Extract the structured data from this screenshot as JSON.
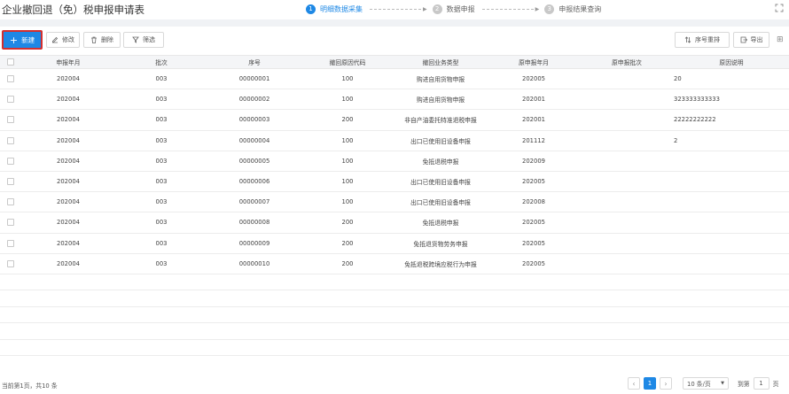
{
  "header": {
    "title": "企业撤回退（免）税申报申请表",
    "steps": [
      {
        "num": "1",
        "label": "明细数据采集"
      },
      {
        "num": "2",
        "label": "数据申报"
      },
      {
        "num": "3",
        "label": "申报结果查询"
      }
    ]
  },
  "toolbar": {
    "new_label": "新建",
    "edit_label": "修改",
    "delete_label": "删除",
    "filter_label": "筛选",
    "reorder_label": "序号重排",
    "export_label": "导出"
  },
  "table": {
    "columns": [
      "申报年月",
      "批次",
      "序号",
      "撤回原因代码",
      "撤回业务类型",
      "原申报年月",
      "原申报批次",
      "原因说明"
    ],
    "rows": [
      [
        "202004",
        "003",
        "00000001",
        "100",
        "购进自用货物申报",
        "202005",
        "",
        "20"
      ],
      [
        "202004",
        "003",
        "00000002",
        "100",
        "购进自用货物申报",
        "202001",
        "",
        "323333333333"
      ],
      [
        "202004",
        "003",
        "00000003",
        "200",
        "非自产油委托特准退税申报",
        "202001",
        "",
        "22222222222"
      ],
      [
        "202004",
        "003",
        "00000004",
        "100",
        "出口已使用旧设备申报",
        "201112",
        "",
        "2"
      ],
      [
        "202004",
        "003",
        "00000005",
        "100",
        "免抵退税申报",
        "202009",
        "",
        ""
      ],
      [
        "202004",
        "003",
        "00000006",
        "100",
        "出口已使用旧设备申报",
        "202005",
        "",
        ""
      ],
      [
        "202004",
        "003",
        "00000007",
        "100",
        "出口已使用旧设备申报",
        "202008",
        "",
        ""
      ],
      [
        "202004",
        "003",
        "00000008",
        "200",
        "免抵退税申报",
        "202005",
        "",
        ""
      ],
      [
        "202004",
        "003",
        "00000009",
        "200",
        "免抵退货物劳务申报",
        "202005",
        "",
        ""
      ],
      [
        "202004",
        "003",
        "00000010",
        "200",
        "免抵退税跨境应税行为申报",
        "202005",
        "",
        ""
      ]
    ]
  },
  "footer": {
    "summary": "当前第1页，共10 条",
    "current_page": "1",
    "page_size": "10 条/页",
    "goto_label": "到第",
    "goto_value": "1",
    "page_suffix": "页"
  },
  "colors": {
    "accent": "#1e88e5",
    "highlight_border": "#d32f2f"
  }
}
